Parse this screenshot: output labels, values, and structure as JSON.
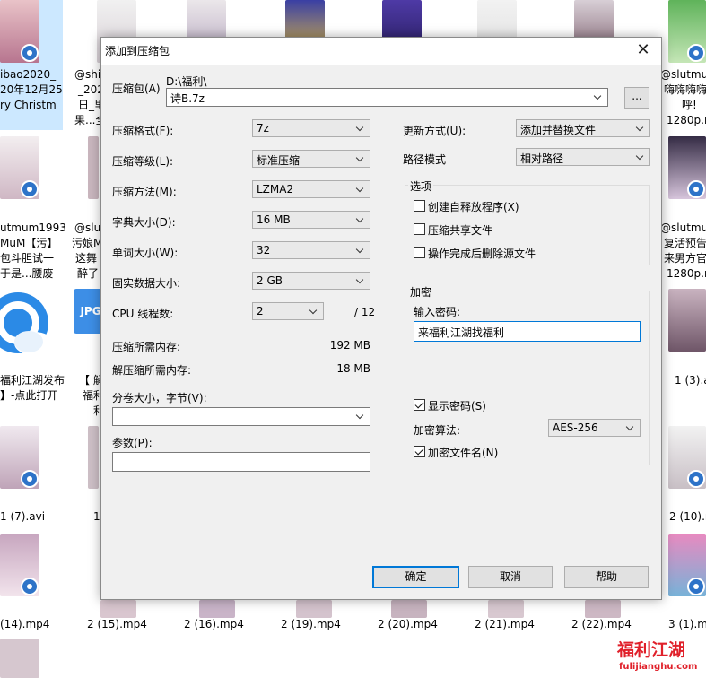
{
  "explorer": {
    "files": {
      "r0c0": [
        "ibao2020_",
        "20年12月25",
        "ry Christm"
      ],
      "r0c1": [
        "@shi",
        "_202",
        "日_里",
        "果...全"
      ],
      "r0c7": [
        "@slutmum",
        "嗨嗨嗨嗨",
        "呼!",
        "1280p.m"
      ],
      "r1c0": [
        "utmum1993",
        "MuM【污】",
        "包斗胆试一",
        "于是...腰废"
      ],
      "r1c1": [
        "@slut",
        "污娘M",
        "这舞",
        "醉了"
      ],
      "r1c7": [
        "@slutmum",
        "复活预告",
        "来男方官",
        "1280p.m"
      ],
      "r2c0": [
        "福利江湖发布",
        "】-点此打开"
      ],
      "r2c1": [
        "【 解",
        "福利",
        "利"
      ],
      "r2c7": [
        "1 (3).avi"
      ],
      "r3c0": [
        "1 (7).avi"
      ],
      "r3c1": [
        "1"
      ],
      "r3c7": [
        "2 (10).m"
      ],
      "r4": [
        "(14).mp4",
        "2 (15).mp4",
        "2 (16).mp4",
        "2 (19).mp4",
        "2 (20).mp4",
        "2 (21).mp4",
        "2 (22).mp4",
        "3 (1).m"
      ]
    },
    "jpg_label": "JPG",
    "watermark": {
      "main": "福利江湖",
      "sub": "fulijianghu.com"
    }
  },
  "dialog": {
    "title": "添加到压缩包",
    "archive": {
      "label": "压缩包(A)",
      "path": "D:\\福利\\",
      "filename": "诗B.7z",
      "browse": "..."
    },
    "left": {
      "format": {
        "label": "压缩格式(F):",
        "value": "7z"
      },
      "level": {
        "label": "压缩等级(L):",
        "value": "标准压缩"
      },
      "method": {
        "label": "压缩方法(M):",
        "value": "LZMA2"
      },
      "dict": {
        "label": "字典大小(D):",
        "value": "16 MB"
      },
      "word": {
        "label": "单词大小(W):",
        "value": "32"
      },
      "solid": {
        "label": "固实数据大小:",
        "value": "2 GB"
      },
      "cpu": {
        "label": "CPU 线程数:",
        "value": "2",
        "total": "/ 12"
      },
      "mem_comp": {
        "label": "压缩所需内存:",
        "value": "192 MB"
      },
      "mem_decomp": {
        "label": "解压缩所需内存:",
        "value": "18 MB"
      },
      "split": {
        "label": "分卷大小，字节(V):",
        "value": ""
      },
      "params": {
        "label": "参数(P):",
        "value": ""
      }
    },
    "right": {
      "update": {
        "label": "更新方式(U):",
        "value": "添加并替换文件"
      },
      "pathmode": {
        "label": "路径模式",
        "value": "相对路径"
      },
      "options": {
        "title": "选项",
        "sfx": {
          "label": "创建自释放程序(X)",
          "checked": false
        },
        "shared": {
          "label": "压缩共享文件",
          "checked": false
        },
        "delete": {
          "label": "操作完成后删除源文件",
          "checked": false
        }
      },
      "encryption": {
        "title": "加密",
        "password_label": "输入密码:",
        "password": "来福利江湖找福利",
        "show_password": {
          "label": "显示密码(S)",
          "checked": true
        },
        "method_label": "加密算法:",
        "method": "AES-256",
        "encrypt_names": {
          "label": "加密文件名(N)",
          "checked": true
        }
      }
    },
    "buttons": {
      "ok": "确定",
      "cancel": "取消",
      "help": "帮助"
    },
    "close_symbol": "✕"
  }
}
